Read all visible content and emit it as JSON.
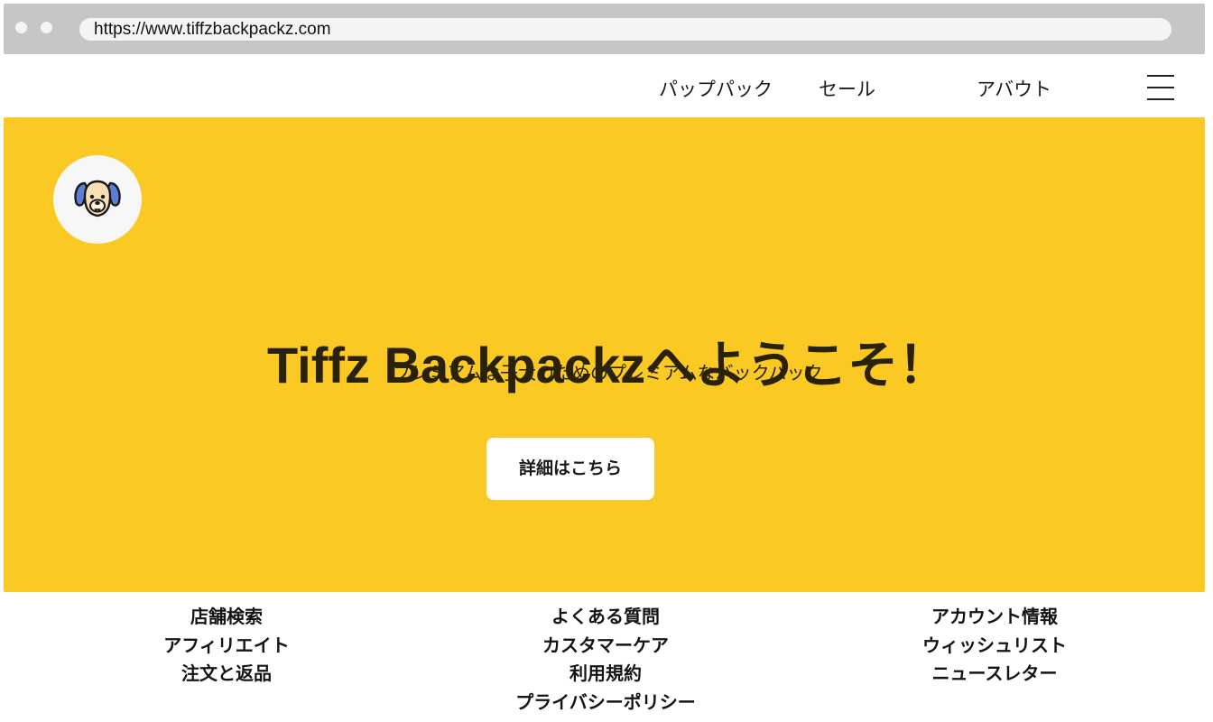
{
  "browser": {
    "url": "https://www.tiffzbackpackz.com"
  },
  "nav": {
    "items": [
      {
        "label": "パップパック"
      },
      {
        "label": "セール"
      },
      {
        "label": "アバウト"
      }
    ],
    "menu_icon": "hamburger-menu-icon"
  },
  "hero": {
    "logo_icon": "dog-face-icon",
    "title": "Tiffz Backpackzへようこそ！",
    "subtitle": "プレミアムな子犬のためのプレミアムなバックパック",
    "cta_label": "詳細はこちら",
    "background_color": "#fbc924"
  },
  "footer": {
    "columns": [
      {
        "links": [
          "店舗検索",
          "アフィリエイト",
          "注文と返品"
        ]
      },
      {
        "links": [
          "よくある質問",
          "カスタマーケア",
          "利用規約",
          "プライバシーポリシー"
        ]
      },
      {
        "links": [
          "アカウント情報",
          "ウィッシュリスト",
          "ニュースレター"
        ]
      }
    ]
  }
}
